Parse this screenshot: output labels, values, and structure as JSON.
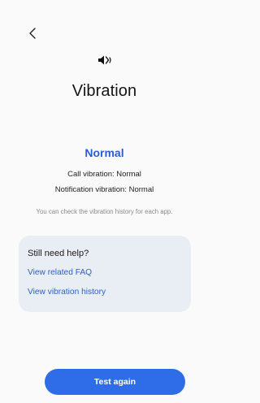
{
  "header": {
    "back_icon": "chevron-left-icon",
    "status_icon": "vibrate-mute-icon",
    "title": "Vibration"
  },
  "result": {
    "status": "Normal",
    "call_vibration": "Call vibration: Normal",
    "notification_vibration": "Notification vibration: Normal",
    "hint": "You can check the vibration history for each app."
  },
  "help": {
    "title": "Still need help?",
    "faq_link": "View related FAQ",
    "history_link": "View vibration history"
  },
  "actions": {
    "test_again": "Test again"
  },
  "colors": {
    "accent": "#2f6de8",
    "link": "#2d5fc9",
    "card_bg": "#e9edf4",
    "background": "#fafafa"
  }
}
